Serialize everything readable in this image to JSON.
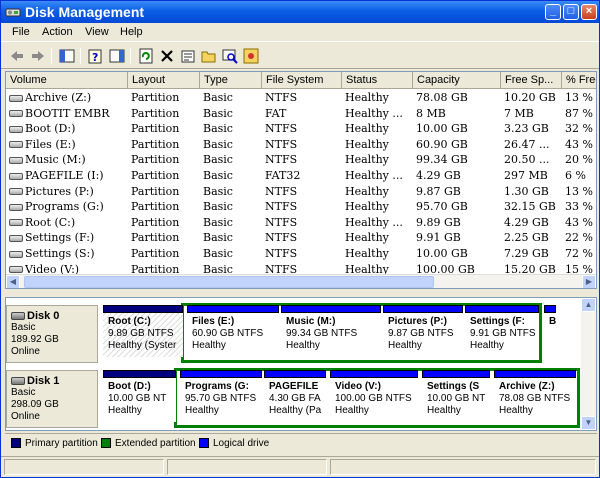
{
  "window": {
    "title": "Disk Management"
  },
  "menu": [
    "File",
    "Action",
    "View",
    "Help"
  ],
  "columns": [
    "Volume",
    "Layout",
    "Type",
    "File System",
    "Status",
    "Capacity",
    "Free Sp...",
    "% Free"
  ],
  "volumes": [
    {
      "name": "Archive (Z:)",
      "layout": "Partition",
      "type": "Basic",
      "fs": "NTFS",
      "status": "Healthy",
      "capacity": "78.08 GB",
      "free": "10.20 GB",
      "pct": "13 %"
    },
    {
      "name": "BOOTIT EMBR",
      "layout": "Partition",
      "type": "Basic",
      "fs": "FAT",
      "status": "Healthy ...",
      "capacity": "8 MB",
      "free": "7 MB",
      "pct": "87 %"
    },
    {
      "name": "Boot (D:)",
      "layout": "Partition",
      "type": "Basic",
      "fs": "NTFS",
      "status": "Healthy",
      "capacity": "10.00 GB",
      "free": "3.23 GB",
      "pct": "32 %"
    },
    {
      "name": "Files (E:)",
      "layout": "Partition",
      "type": "Basic",
      "fs": "NTFS",
      "status": "Healthy",
      "capacity": "60.90 GB",
      "free": "26.47 ...",
      "pct": "43 %"
    },
    {
      "name": "Music (M:)",
      "layout": "Partition",
      "type": "Basic",
      "fs": "NTFS",
      "status": "Healthy",
      "capacity": "99.34 GB",
      "free": "20.50 ...",
      "pct": "20 %"
    },
    {
      "name": "PAGEFILE (I:)",
      "layout": "Partition",
      "type": "Basic",
      "fs": "FAT32",
      "status": "Healthy ...",
      "capacity": "4.29 GB",
      "free": "297 MB",
      "pct": "6 %"
    },
    {
      "name": "Pictures (P:)",
      "layout": "Partition",
      "type": "Basic",
      "fs": "NTFS",
      "status": "Healthy",
      "capacity": "9.87 GB",
      "free": "1.30 GB",
      "pct": "13 %"
    },
    {
      "name": "Programs (G:)",
      "layout": "Partition",
      "type": "Basic",
      "fs": "NTFS",
      "status": "Healthy",
      "capacity": "95.70 GB",
      "free": "32.15 GB",
      "pct": "33 %"
    },
    {
      "name": "Root (C:)",
      "layout": "Partition",
      "type": "Basic",
      "fs": "NTFS",
      "status": "Healthy ...",
      "capacity": "9.89 GB",
      "free": "4.29 GB",
      "pct": "43 %"
    },
    {
      "name": "Settings (F:)",
      "layout": "Partition",
      "type": "Basic",
      "fs": "NTFS",
      "status": "Healthy",
      "capacity": "9.91 GB",
      "free": "2.25 GB",
      "pct": "22 %"
    },
    {
      "name": "Settings (S:)",
      "layout": "Partition",
      "type": "Basic",
      "fs": "NTFS",
      "status": "Healthy",
      "capacity": "10.00 GB",
      "free": "7.29 GB",
      "pct": "72 %"
    },
    {
      "name": "Video (V:)",
      "layout": "Partition",
      "type": "Basic",
      "fs": "NTFS",
      "status": "Healthy",
      "capacity": "100.00 GB",
      "free": "15.20 GB",
      "pct": "15 %"
    }
  ],
  "disks": [
    {
      "name": "Disk 0",
      "kind": "Basic",
      "size": "189.92 GB",
      "state": "Online",
      "partitions": [
        {
          "name": "Root  (C:)",
          "size": "9.89 GB NTFS",
          "status": "Healthy (Syster"
        },
        {
          "name": "Files  (E:)",
          "size": "60.90 GB NTFS",
          "status": "Healthy"
        },
        {
          "name": "Music  (M:)",
          "size": "99.34 GB NTFS",
          "status": "Healthy"
        },
        {
          "name": "Pictures  (P:)",
          "size": "9.87 GB NTFS",
          "status": "Healthy"
        },
        {
          "name": "Settings  (F:",
          "size": "9.91 GB NTFS",
          "status": "Healthy"
        },
        {
          "name": "B",
          "size": "",
          "status": ""
        }
      ]
    },
    {
      "name": "Disk 1",
      "kind": "Basic",
      "size": "298.09 GB",
      "state": "Online",
      "partitions": [
        {
          "name": "Boot  (D:)",
          "size": "10.00 GB NT",
          "status": "Healthy"
        },
        {
          "name": "Programs  (G:",
          "size": "95.70 GB NTFS",
          "status": "Healthy"
        },
        {
          "name": "PAGEFILE",
          "size": "4.30 GB FA",
          "status": "Healthy (Pa"
        },
        {
          "name": "Video  (V:)",
          "size": "100.00 GB NTFS",
          "status": "Healthy"
        },
        {
          "name": "Settings  (S",
          "size": "10.00 GB NT",
          "status": "Healthy"
        },
        {
          "name": "Archive  (Z:)",
          "size": "78.08 GB NTFS",
          "status": "Healthy"
        }
      ]
    }
  ],
  "legend": {
    "primary": "Primary partition",
    "extended": "Extended partition",
    "logical": "Logical drive"
  },
  "colors": {
    "primary": "#00007E",
    "extended": "#008000",
    "logical": "#0000FF",
    "titlebar": "#0B5EE6"
  }
}
